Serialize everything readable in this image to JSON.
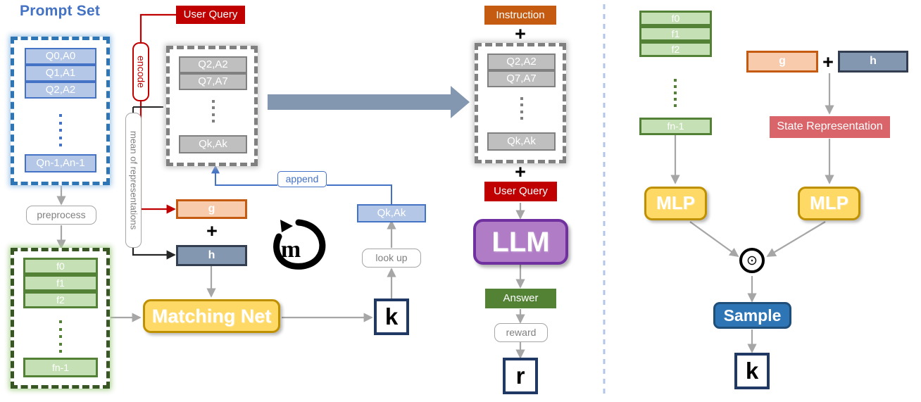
{
  "diagram": {
    "title_prompt_set": "Prompt Set",
    "left_panel": {
      "prompt_set_items": [
        "Q0,A0",
        "Q1,A1",
        "Q2,A2"
      ],
      "prompt_set_last": "Qn-1,An-1",
      "preprocess_label": "preprocess",
      "feature_items": [
        "f0",
        "f1",
        "f2"
      ],
      "feature_last": "fn-1",
      "user_query_label": "User Query",
      "encode_label": "encode",
      "mean_label": "mean of representations",
      "selected_items": [
        "Q2,A2",
        "Q7,A7"
      ],
      "selected_last": "Qk,Ak",
      "g_label": "g",
      "h_label": "h",
      "plus_symbol": "+",
      "matching_net_label": "Matching Net",
      "k_label": "k",
      "lookup_label": "look up",
      "append_label": "append",
      "qkak_label": "Qk,Ak",
      "m_label": "m"
    },
    "middle_panel": {
      "instruction_label": "Instruction",
      "plus_symbol": "+",
      "context_items": [
        "Q2,A2",
        "Q7,A7"
      ],
      "context_last": "Qk,Ak",
      "user_query_label": "User Query",
      "llm_label": "LLM",
      "answer_label": "Answer",
      "reward_label": "reward",
      "r_label": "r"
    },
    "right_panel": {
      "feature_items": [
        "f0",
        "f1",
        "f2"
      ],
      "feature_last": "fn-1",
      "g_label": "g",
      "h_label": "h",
      "plus_symbol": "+",
      "state_representation_label": "State Representation",
      "mlp_left_label": "MLP",
      "mlp_right_label": "MLP",
      "hadamard_symbol": "⊙",
      "sample_label": "Sample",
      "k_label": "k"
    },
    "colors": {
      "prompt_blue": "#4472c4",
      "prompt_fill": "#b4c7e7",
      "feature_green": "#538135",
      "feature_fill": "#c5e0b4",
      "user_query_red": "#c00000",
      "instruction_orange": "#c55a11",
      "g_fill": "#f8cbad",
      "h_fill": "#8497b0",
      "answer_green": "#548235",
      "llm_purple": "#b07cc6",
      "mlp_yellow": "#ffd966",
      "sample_blue": "#2e75b6",
      "state_red": "#d9656a",
      "arrow_gray": "#a6a6a6",
      "big_arrow_blue": "#8497b0"
    }
  }
}
